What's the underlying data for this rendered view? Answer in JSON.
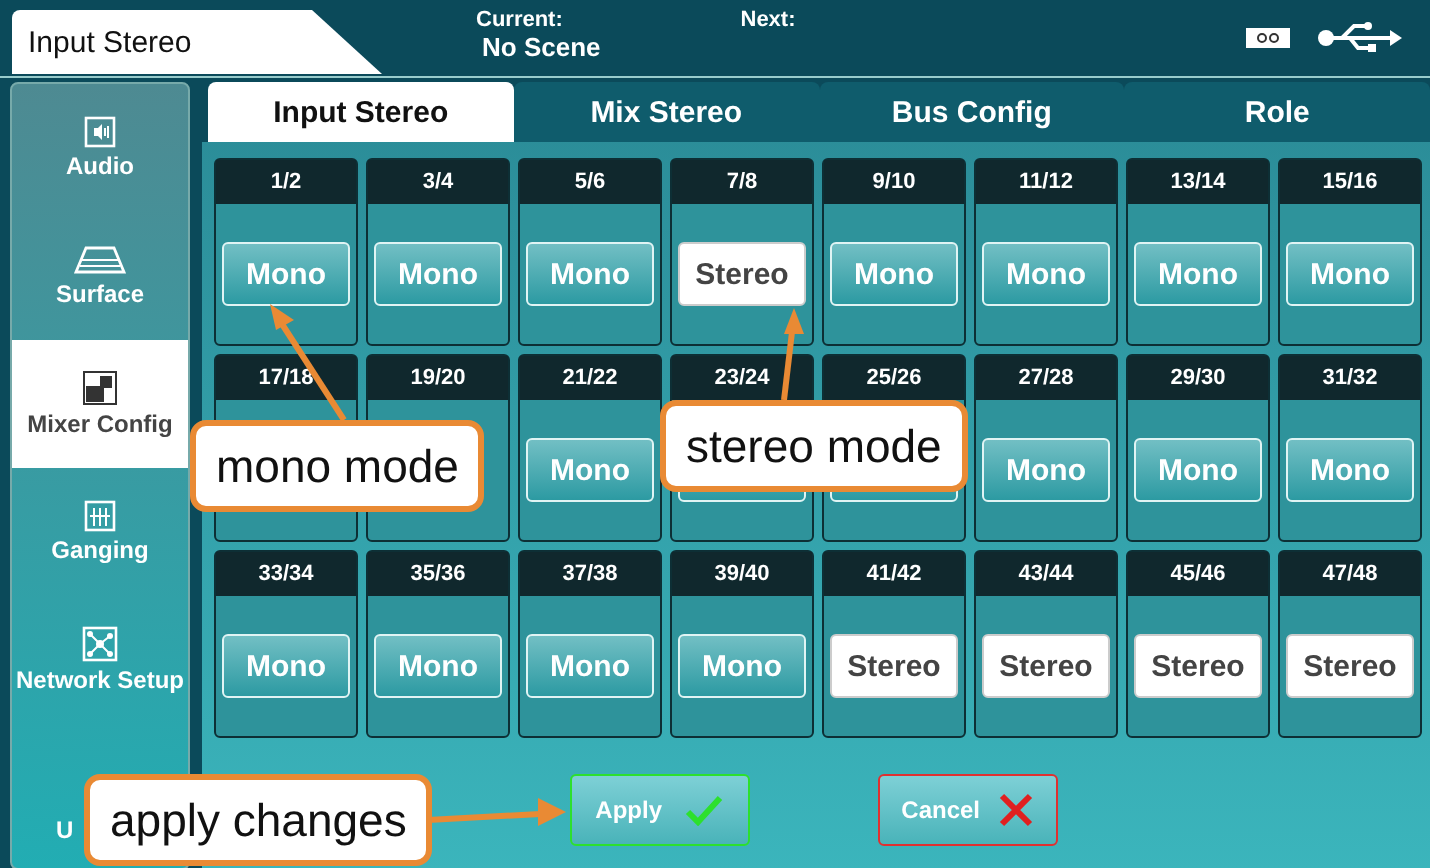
{
  "title_tab": "Input Stereo",
  "scene": {
    "current_label": "Current:",
    "current_value": "No Scene",
    "next_label": "Next:"
  },
  "sidebar": {
    "items": [
      {
        "label": "Audio",
        "selected": false
      },
      {
        "label": "Surface",
        "selected": false
      },
      {
        "label": "Mixer Config",
        "selected": true
      },
      {
        "label": "Ganging",
        "selected": false
      },
      {
        "label": "Network Setup",
        "selected": false
      },
      {
        "label": "U",
        "selected": false
      }
    ]
  },
  "tabs": [
    {
      "label": "Input Stereo",
      "selected": true
    },
    {
      "label": "Mix Stereo",
      "selected": false
    },
    {
      "label": "Bus Config",
      "selected": false
    },
    {
      "label": "Role",
      "selected": false
    }
  ],
  "channels": [
    {
      "label": "1/2",
      "button": {
        "kind": "mono",
        "text": "Mono"
      }
    },
    {
      "label": "3/4",
      "button": {
        "kind": "mono",
        "text": "Mono"
      }
    },
    {
      "label": "5/6",
      "button": {
        "kind": "mono",
        "text": "Mono"
      }
    },
    {
      "label": "7/8",
      "button": {
        "kind": "stereo",
        "text": "Stereo"
      }
    },
    {
      "label": "9/10",
      "button": {
        "kind": "mono",
        "text": "Mono"
      }
    },
    {
      "label": "11/12",
      "button": {
        "kind": "mono",
        "text": "Mono"
      }
    },
    {
      "label": "13/14",
      "button": {
        "kind": "mono",
        "text": "Mono"
      }
    },
    {
      "label": "15/16",
      "button": {
        "kind": "mono",
        "text": "Mono"
      }
    },
    {
      "label": "17/18"
    },
    {
      "label": "19/20"
    },
    {
      "label": "21/22",
      "button": {
        "kind": "mono",
        "text": "Mono"
      }
    },
    {
      "label": "23/24",
      "button": {
        "kind": "mono"
      }
    },
    {
      "label": "25/26",
      "button": {
        "kind": "mono"
      }
    },
    {
      "label": "27/28",
      "button": {
        "kind": "mono",
        "text": "Mono"
      }
    },
    {
      "label": "29/30",
      "button": {
        "kind": "mono",
        "text": "Mono"
      }
    },
    {
      "label": "31/32",
      "button": {
        "kind": "mono",
        "text": "Mono"
      }
    },
    {
      "label": "33/34",
      "button": {
        "kind": "mono",
        "text": "Mono"
      }
    },
    {
      "label": "35/36",
      "button": {
        "kind": "mono",
        "text": "Mono"
      }
    },
    {
      "label": "37/38",
      "button": {
        "kind": "mono",
        "text": "Mono"
      }
    },
    {
      "label": "39/40",
      "button": {
        "kind": "mono",
        "text": "Mono"
      }
    },
    {
      "label": "41/42",
      "button": {
        "kind": "stereo",
        "text": "Stereo"
      }
    },
    {
      "label": "43/44",
      "button": {
        "kind": "stereo",
        "text": "Stereo"
      }
    },
    {
      "label": "45/46",
      "button": {
        "kind": "stereo",
        "text": "Stereo"
      }
    },
    {
      "label": "47/48",
      "button": {
        "kind": "stereo",
        "text": "Stereo"
      }
    }
  ],
  "actions": [
    {
      "label": "Apply",
      "kind": "apply"
    },
    {
      "label": "Cancel",
      "kind": "cancel"
    }
  ],
  "callouts": [
    "mono mode",
    "stereo mode",
    "apply changes"
  ]
}
